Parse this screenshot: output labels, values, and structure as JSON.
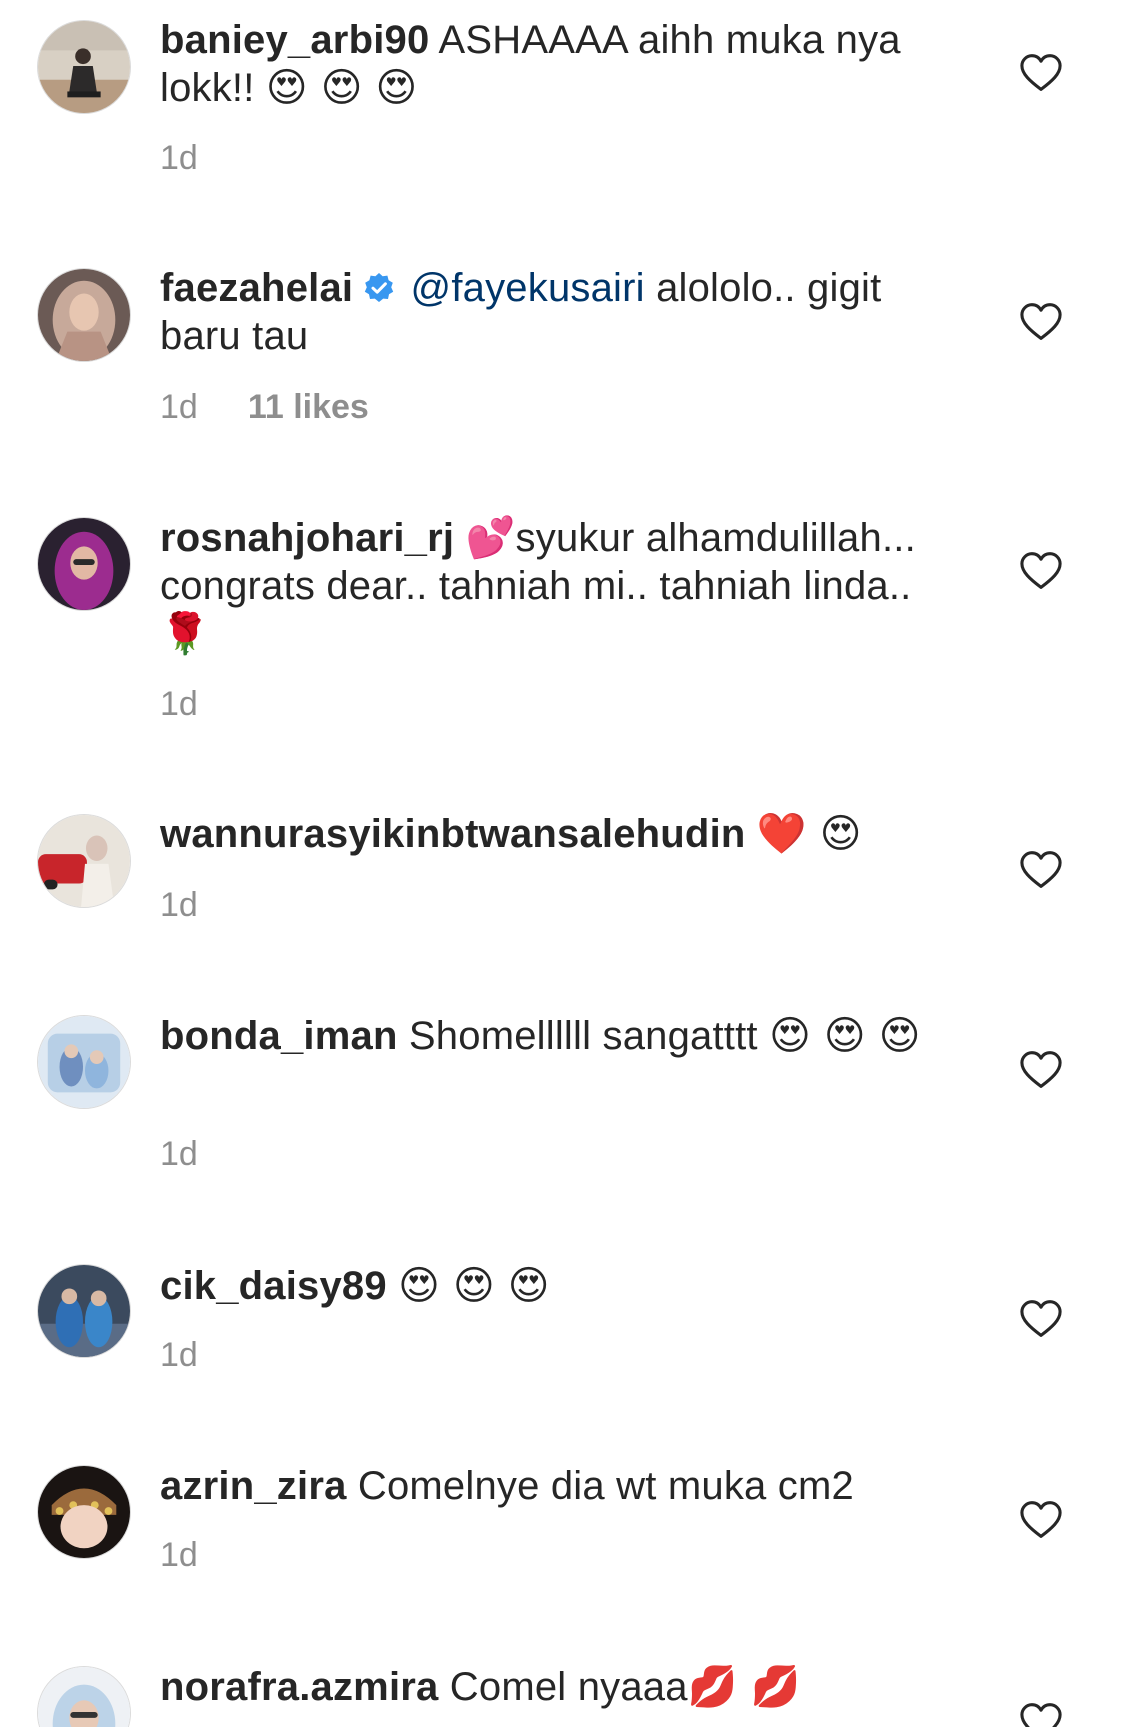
{
  "comments": [
    {
      "username": "baniey_arbi90",
      "text": "ASHAAAA aihh muka nya lokk!!",
      "emoji": "😍 😍 😍",
      "time": "1d"
    },
    {
      "username": "faezahelai",
      "verified": true,
      "mention": "@fayekusairi",
      "text": "alololo.. gigit baru tau",
      "time": "1d",
      "likes": "11 likes"
    },
    {
      "username": "rosnahjohari_rj",
      "emoji_before": "💕",
      "text": "syukur alhamdulillah... congrats dear.. tahniah mi.. tahniah linda..",
      "emoji": "🌹",
      "time": "1d"
    },
    {
      "username": "wannurasyikinbtwansalehudin",
      "emoji": "❤️ 😍",
      "time": "1d"
    },
    {
      "username": "bonda_iman",
      "text": "Shomellllll sangatttt",
      "emoji": "😍 😍 😍",
      "time": "1d"
    },
    {
      "username": "cik_daisy89",
      "emoji": "😍 😍 😍",
      "time": "1d"
    },
    {
      "username": "azrin_zira",
      "text": "Comelnye dia wt muka cm2",
      "time": "1d"
    },
    {
      "username": "norafra.azmira",
      "text": "Comel nyaaa",
      "emoji": "💋 💋"
    }
  ],
  "icons": {
    "like": "heart-outline-icon",
    "verified": "verified-badge-icon"
  },
  "colors": {
    "text": "#262626",
    "meta": "#8e8e8e",
    "mention": "#003569",
    "verified": "#3897f0",
    "heart_stroke": "#262626"
  }
}
